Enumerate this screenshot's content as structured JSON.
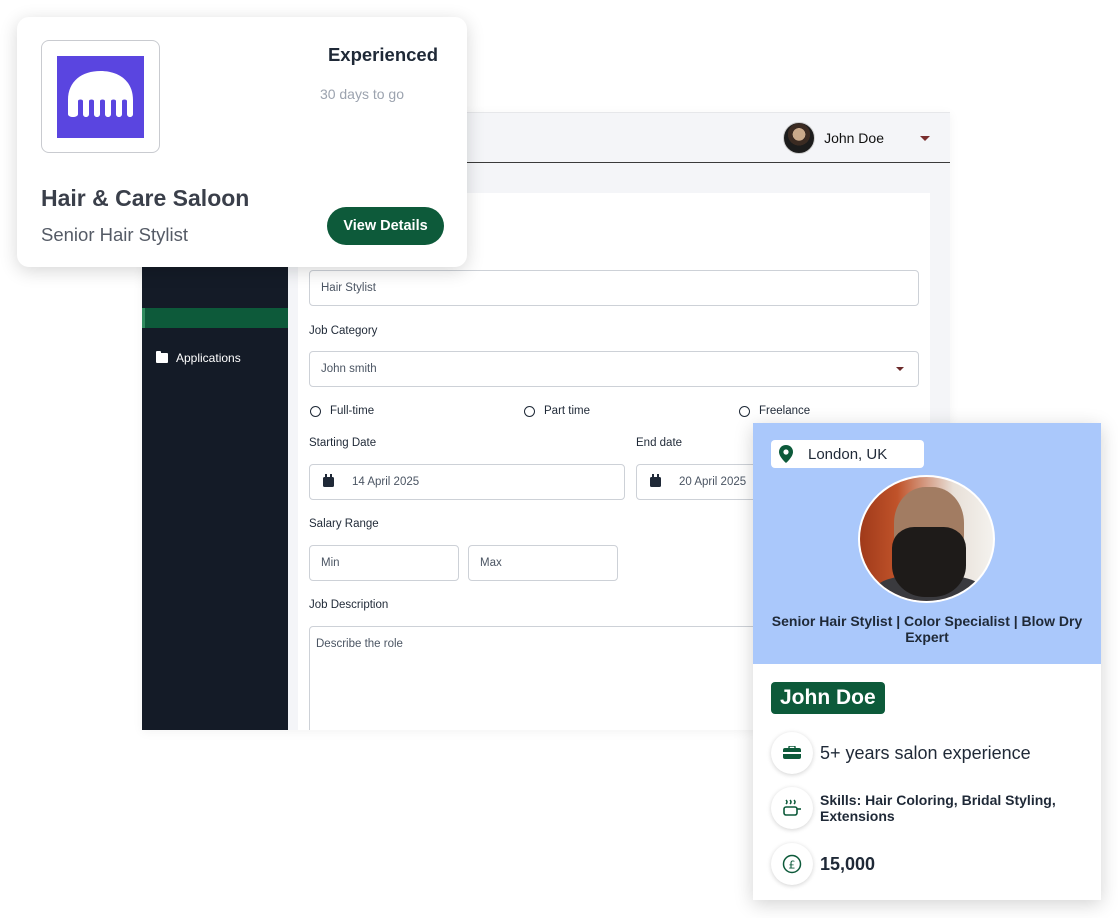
{
  "colors": {
    "brand_green": "#0d5a3a",
    "sidebar_bg": "#141b27",
    "profile_header_bg": "#aac8fb",
    "logo_purple": "#5a45e0"
  },
  "dashboard": {
    "user": {
      "name": "John Doe",
      "avatar_icon": "user-avatar"
    },
    "sidebar": {
      "items": [
        {
          "label": "Applications",
          "icon": "folder-icon"
        }
      ]
    },
    "form": {
      "job_title_value": "Hair Stylist",
      "job_category_label": "Job Category",
      "job_category_value": "John smith",
      "employment_types": [
        "Full-time",
        "Part time",
        "Freelance"
      ],
      "starting_date_label": "Starting Date",
      "starting_date_value": "14 April 2025",
      "end_date_label": "End date",
      "end_date_value": "20 April 2025",
      "salary_label": "Salary Range",
      "salary_min_placeholder": "Min",
      "salary_max_placeholder": "Max",
      "description_label": "Job Description",
      "description_placeholder": "Describe the role"
    }
  },
  "job_card": {
    "logo_icon": "kraken-logo-icon",
    "level": "Experienced",
    "deadline": "30 days to go",
    "company": "Hair & Care Saloon",
    "role": "Senior Hair Stylist",
    "button_label": "View Details"
  },
  "profile_card": {
    "location": "London, UK",
    "headline": "Senior Hair Stylist | Color Specialist | Blow Dry Expert",
    "name": "John Doe",
    "experience": "5+ years salon experience",
    "skills": "Skills: Hair Coloring, Bridal Styling, Extensions",
    "salary": "15,000"
  }
}
